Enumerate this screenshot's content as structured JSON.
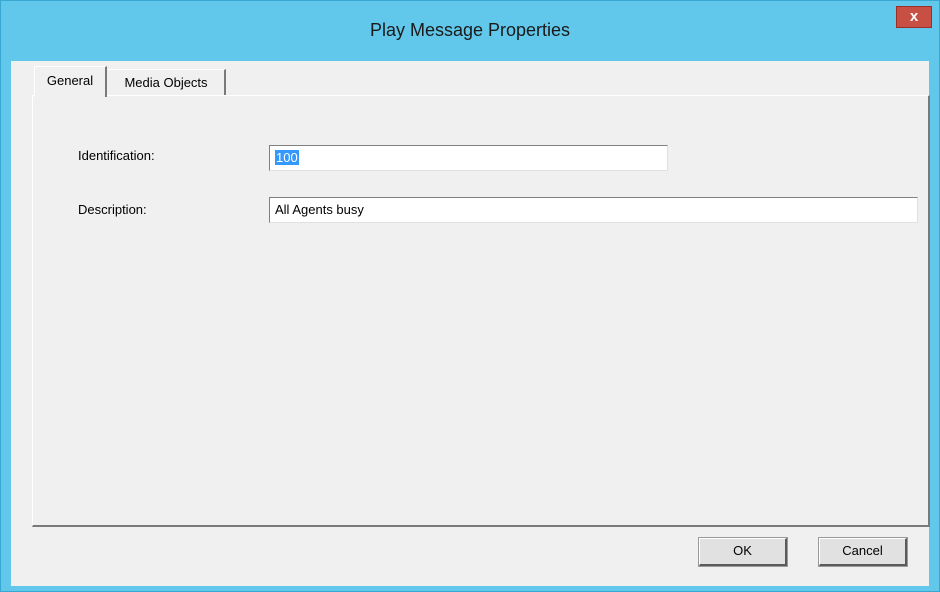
{
  "window": {
    "title": "Play Message Properties",
    "close_glyph": "x",
    "accent_color": "#62c8eb"
  },
  "tabs": [
    {
      "label": "General",
      "selected": true
    },
    {
      "label": "Media Objects",
      "selected": false
    }
  ],
  "general": {
    "identification_label": "Identification:",
    "identification_value": "100",
    "description_label": "Description:",
    "description_value": "All Agents busy"
  },
  "buttons": {
    "ok_label": "OK",
    "cancel_label": "Cancel"
  },
  "icons": {
    "close": "close-icon"
  }
}
